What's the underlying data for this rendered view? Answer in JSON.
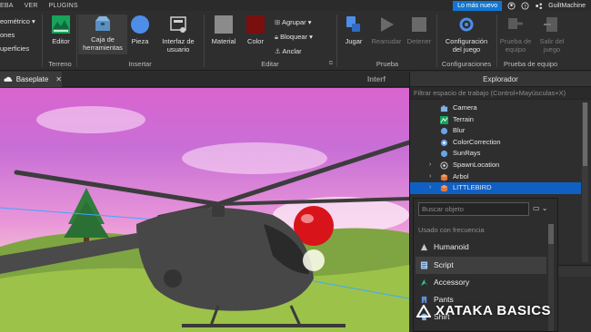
{
  "menu": {
    "items": [
      "EBA",
      "VER",
      "PLUGINS"
    ]
  },
  "topbar": {
    "news_label": "Lo más nuevo",
    "username": "GuiltMachine"
  },
  "ribbon": {
    "left_items": [
      "eométrico ▾",
      "ones",
      "uperficies"
    ],
    "editor_label": "Editor",
    "terreno_label": "Terreno",
    "toolbox_label": "Caja de herramientas",
    "piece_label": "Pieza",
    "ui_label": "Interfaz de usuario",
    "insertar_label": "Insertar",
    "material_label": "Material",
    "color_label": "Color",
    "group_label": "Agrupar ▾",
    "lock_label": "Bloquear ▾",
    "anchor_label": "Anclar",
    "editar_label": "Editar",
    "play_label": "Jugar",
    "resume_label": "Reanudar",
    "stop_label": "Detener",
    "prueba_label": "Prueba",
    "game_settings_label": "Configuración del juego",
    "configuraciones_label": "Configuraciones",
    "team_test_label": "Prueba de equipo",
    "exit_game_label": "Salir del juego",
    "prueba_equipo_label": "Prueba de equipo"
  },
  "document": {
    "tab_label": "Baseplate",
    "interface_label": "Interf"
  },
  "explorer": {
    "title": "Explorador",
    "filter_placeholder": "Filtrar espacio de trabajo (Control+Mayúsculas+X)",
    "items": [
      {
        "label": "Camera",
        "icon": "camera-icon",
        "expand": ""
      },
      {
        "label": "Terrain",
        "icon": "terrain-icon",
        "expand": ""
      },
      {
        "label": "Blur",
        "icon": "blur-icon",
        "expand": ""
      },
      {
        "label": "ColorCorrection",
        "icon": "color-correction-icon",
        "expand": ""
      },
      {
        "label": "SunRays",
        "icon": "sunrays-icon",
        "expand": ""
      },
      {
        "label": "SpawnLocation",
        "icon": "spawn-icon",
        "expand": "›"
      },
      {
        "label": "Arbol",
        "icon": "model-icon",
        "expand": "›"
      },
      {
        "label": "LITTLEBIRD",
        "icon": "model-icon",
        "expand": "›"
      }
    ]
  },
  "insert_popup": {
    "search_placeholder": "Buscar objeto",
    "frequent_label": "Usado con frecuencia",
    "objects": [
      {
        "label": "Humanoid",
        "icon": "humanoid-icon"
      },
      {
        "label": "Script",
        "icon": "script-icon"
      },
      {
        "label": "Accessory",
        "icon": "accessory-icon"
      },
      {
        "label": "Pants",
        "icon": "pants-icon"
      },
      {
        "label": "Shirt",
        "icon": "shirt-icon"
      }
    ]
  },
  "watermark": {
    "text": "XATAKA BASICS"
  },
  "colors": {
    "selection": "#1060c4",
    "news_button": "#1176d1",
    "panel_bg": "#2e2e2e"
  }
}
